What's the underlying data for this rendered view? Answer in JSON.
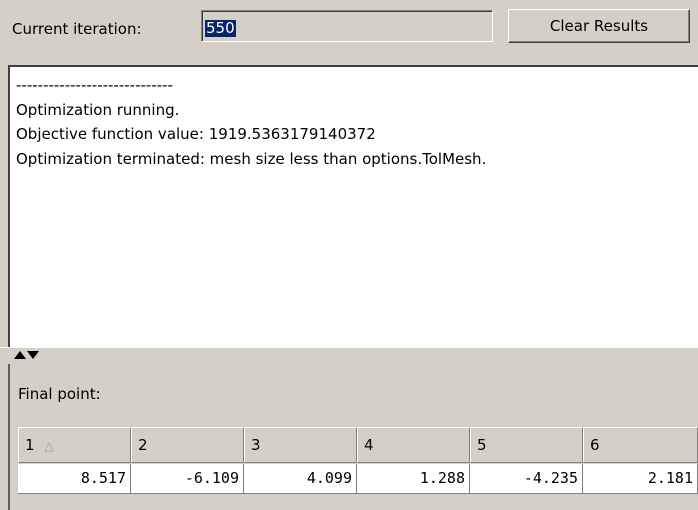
{
  "toolbar": {
    "iteration_label": "Current iteration:",
    "iteration_value": "550",
    "clear_button_label": "Clear Results"
  },
  "results": {
    "lines": [
      "-----------------------------",
      "Optimization running.",
      "Objective function value: 1919.5363179140372",
      "Optimization terminated: mesh size less than options.TolMesh."
    ]
  },
  "splitter": {
    "up_icon": "triangle-up-icon",
    "down_icon": "triangle-down-icon"
  },
  "final_point": {
    "label": "Final point:",
    "headers": [
      "1",
      "2",
      "3",
      "4",
      "5",
      "6"
    ],
    "values": [
      "8.517",
      "-6.109",
      "4.099",
      "1.288",
      "-4.235",
      "2.181"
    ],
    "sort_icon": "sort-ascending-icon"
  },
  "colors": {
    "window_bg": "#d4d0c8",
    "selection_bg": "#0a246a",
    "text_bg": "#ffffff"
  }
}
